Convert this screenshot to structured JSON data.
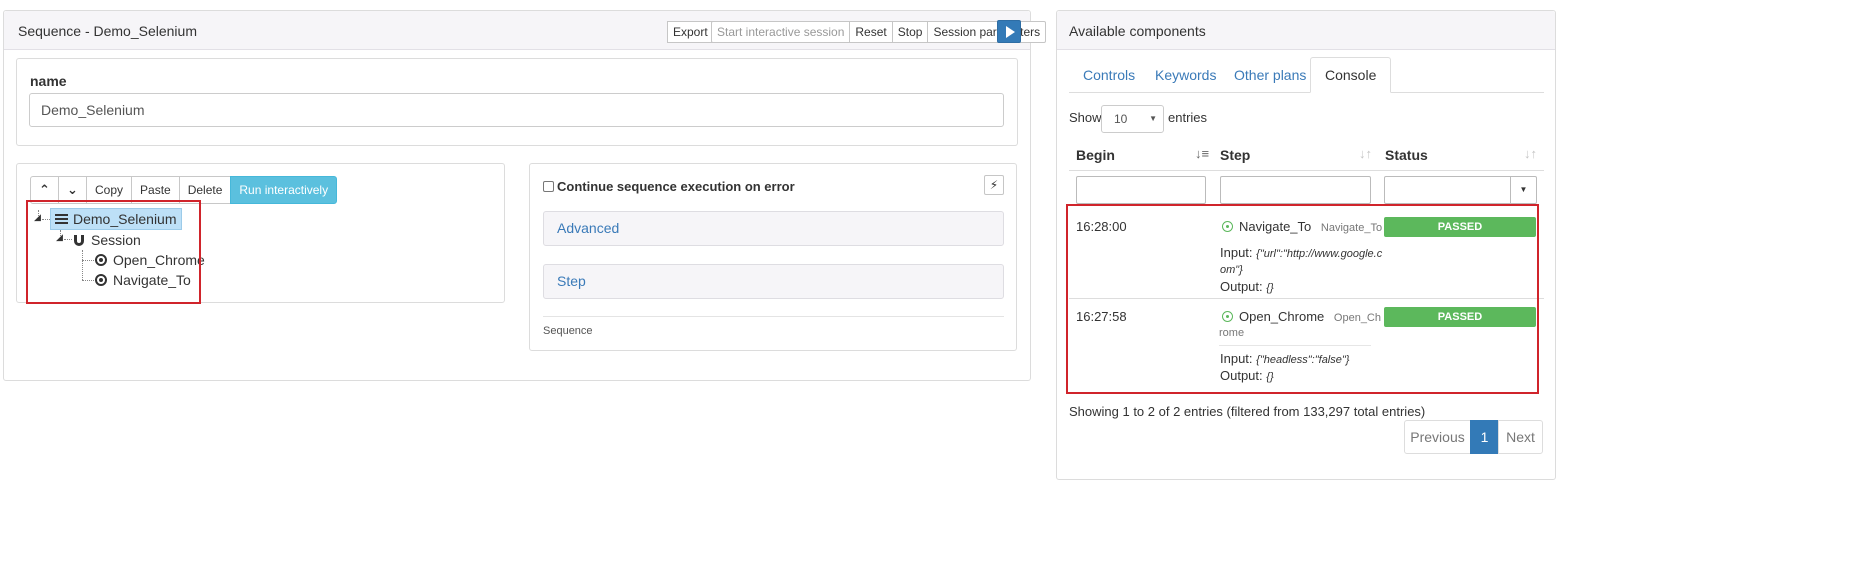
{
  "sequence_panel": {
    "title": "Sequence - Demo_Selenium",
    "toolbar": {
      "export": "Export",
      "start_interactive": "Start interactive session",
      "reset": "Reset",
      "stop": "Stop",
      "session_params": "Session parameters"
    },
    "name_label": "name",
    "name_value": "Demo_Selenium"
  },
  "tree_toolbar": {
    "up": "⌃",
    "down": "⌄",
    "copy": "Copy",
    "paste": "Paste",
    "delete": "Delete",
    "run": "Run interactively"
  },
  "tree": {
    "root": "Demo_Selenium",
    "session": "Session",
    "child1": "Open_Chrome",
    "child2": "Navigate_To"
  },
  "details": {
    "checkbox_label": "Continue sequence execution on error",
    "advanced": "Advanced",
    "step": "Step",
    "footer": "Sequence"
  },
  "components_panel": {
    "title": "Available components",
    "tabs": [
      "Controls",
      "Keywords",
      "Other plans",
      "Console"
    ],
    "active_tab": "Console",
    "show_label": "Show",
    "entries_value": "10",
    "entries_label": "entries",
    "columns": [
      "Begin",
      "Step",
      "Status"
    ],
    "rows": [
      {
        "begin": "16:28:00",
        "step_name": "Navigate_To",
        "step_tag": "Navigate_To",
        "input_label": "Input:",
        "input_line1": "{\"url\":\"http://www.google.c",
        "input_line2": "om\"}",
        "output_label": "Output:",
        "output_value": "{}",
        "status": "PASSED"
      },
      {
        "begin": "16:27:58",
        "step_name": "Open_Chrome",
        "step_tag1": "Open_Ch",
        "step_tag2": "rome",
        "input_label": "Input:",
        "input_value": "{\"headless\":\"false\"}",
        "output_label": "Output:",
        "output_value": "{}",
        "status": "PASSED"
      }
    ],
    "summary": "Showing 1 to 2 of 2 entries (filtered from 133,297 total entries)",
    "pagination": {
      "previous": "Previous",
      "page": "1",
      "next": "Next"
    }
  },
  "colors": {
    "primary": "#337ab7",
    "info": "#5bc0de",
    "success": "#5cb85c",
    "highlight": "#d0242b",
    "link": "#3a7ab8"
  }
}
